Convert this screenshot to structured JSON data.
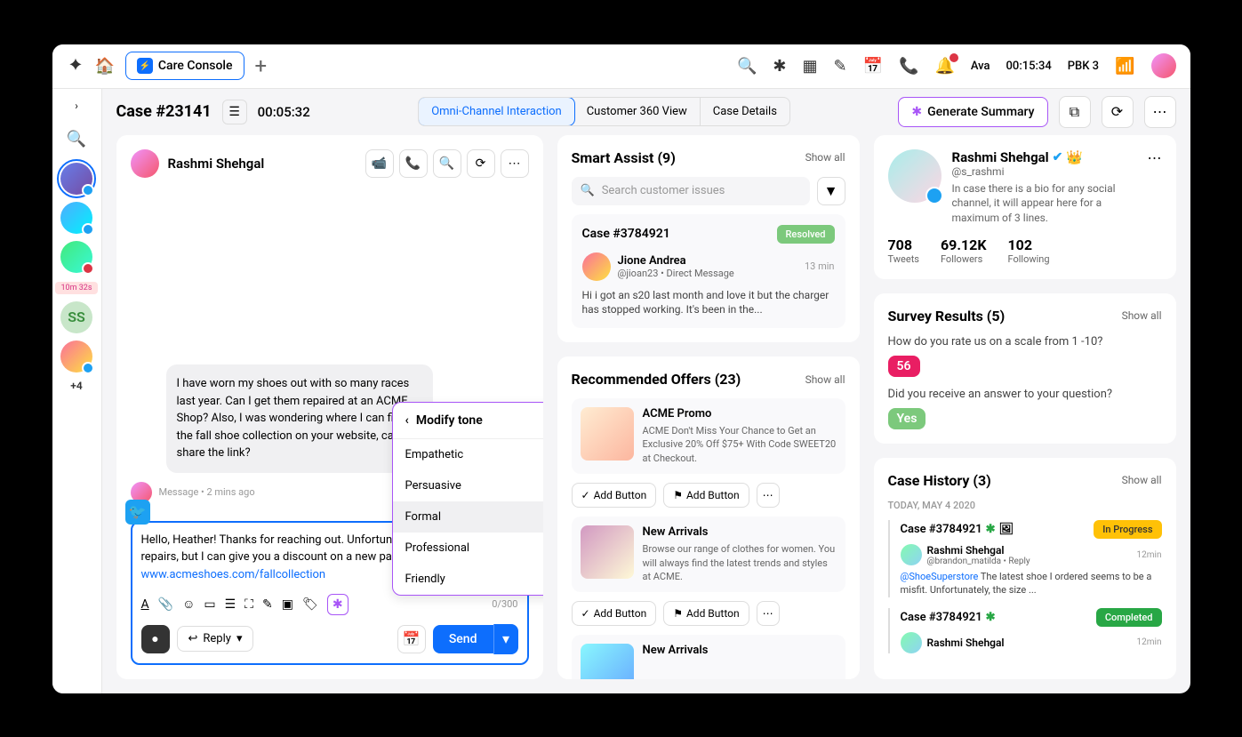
{
  "topbar": {
    "tab_title": "Care Console",
    "user_name": "Ava",
    "timer": "00:15:34",
    "status": "PBK 3"
  },
  "leftbar": {
    "timer_badge": "10m 32s",
    "more": "+4",
    "initials": "SS"
  },
  "casebar": {
    "title": "Case #23141",
    "timer": "00:05:32",
    "tabs": [
      "Omni-Channel Interaction",
      "Customer 360 View",
      "Case Details"
    ],
    "generate": "Generate Summary"
  },
  "chat": {
    "name": "Rashmi Shehgal",
    "bubble": "I have worn my shoes out with so many races last year. Can I get them repaired at an ACME Shop? Also, I was wondering where I can find the fall shoe collection on your website, can you share the link?",
    "meta": "Message • 2 mins ago",
    "compose": "Hello, Heather! Thanks for reaching out. Unfortunately, we can't provide repairs, but I can give you a discount on a new pair of shoes: ",
    "compose_link": "www.acmeshoes.com/fallcollection",
    "char": "0/300",
    "reply": "Reply",
    "send": "Send"
  },
  "popover": {
    "title": "Modify tone",
    "items": [
      "Empathetic",
      "Persuasive",
      "Formal",
      "Professional",
      "Friendly"
    ]
  },
  "smartassist": {
    "title": "Smart Assist (9)",
    "showall": "Show all",
    "search": "Search customer issues",
    "case": {
      "num": "Case #3784921",
      "status": "Resolved",
      "user": "Jione Andrea",
      "handle": "@jioan23 • Direct Message",
      "time": "13 min",
      "text": "Hi i got an s20 last month and love it but the charger has stopped working.  It's been in the..."
    }
  },
  "offers": {
    "title": "Recommended Offers (23)",
    "showall": "Show all",
    "add": "Add Button",
    "items": [
      {
        "title": "ACME Promo",
        "desc": "ACME Don't Miss Your Chance to Get an Exclusive 20% Off $75+ With Code SWEET20 at Checkout."
      },
      {
        "title": "New Arrivals",
        "desc": "Browse our range of clothes for women. You will always find the latest trends and styles at ACME."
      },
      {
        "title": "New Arrivals",
        "desc": ""
      }
    ]
  },
  "profile": {
    "name": "Rashmi Shehgal",
    "handle": "@s_rashmi",
    "bio": "In case there is a bio for any social channel, it will appear here for a maximum of 3 lines.",
    "stats": [
      {
        "val": "708",
        "label": "Tweets"
      },
      {
        "val": "69.12K",
        "label": "Followers"
      },
      {
        "val": "102",
        "label": "Following"
      }
    ]
  },
  "survey": {
    "title": "Survey Results (5)",
    "showall": "Show all",
    "q1": "How do you rate us on a scale from 1 -10?",
    "a1": "56",
    "q2": "Did you receive an answer to your question?",
    "a2": "Yes"
  },
  "history": {
    "title": "Case History (3)",
    "showall": "Show all",
    "date": "TODAY, MAY 4 2020",
    "items": [
      {
        "case": "Case #3784921",
        "status": "In Progress",
        "name": "Rashmi Shehgal",
        "handle": "@brandon_matilda • Reply",
        "time": "12min",
        "text": "@ShoeSuperstore The latest shoe I ordered seems to be a misfit. Unfortunately, the size ..."
      },
      {
        "case": "Case #3784921",
        "status": "Completed",
        "name": "Rashmi Shehgal",
        "handle": "",
        "time": "12min",
        "text": ""
      }
    ]
  }
}
